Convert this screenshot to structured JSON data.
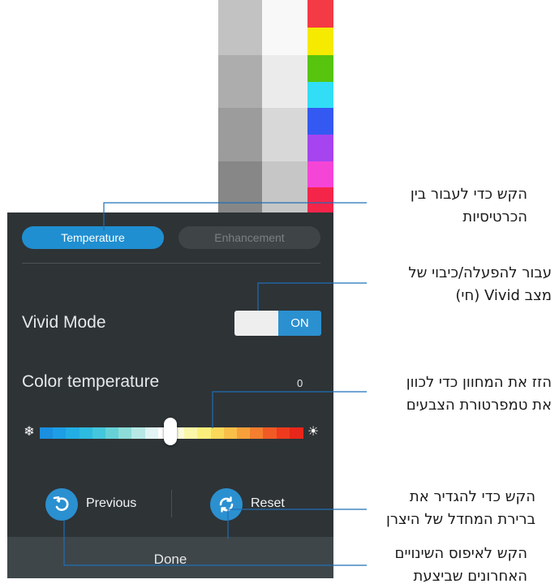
{
  "tabs": {
    "temperature": "Temperature",
    "enhancement": "Enhancement"
  },
  "vivid_mode": {
    "label": "Vivid Mode",
    "state": "ON"
  },
  "color_temperature": {
    "label": "Color temperature",
    "value": "0"
  },
  "actions": {
    "previous": "Previous",
    "reset": "Reset",
    "done": "Done"
  },
  "icons": {
    "cold": "snowflake-icon",
    "warm": "sun-icon",
    "previous": "undo-arrow-icon",
    "reset": "refresh-icon"
  },
  "colors": {
    "panel_bg": "#2e3336",
    "accent": "#1f8fd1",
    "done_bar": "#3e4649"
  },
  "callouts": {
    "tabs": [
      "הקש כדי לעבור בין",
      "הכרטיסיות"
    ],
    "vivid": [
      "עבור להפעלה/כיבוי של",
      "מצב Vivid (חי)"
    ],
    "slider": [
      "הזז את המחוון כדי לכוון",
      "את טמפרטורת הצבעים"
    ],
    "reset": [
      "הקש כדי להגדיר את",
      "ברירת המחדל של היצרן"
    ],
    "previous": [
      "הקש לאיפוס השינויים",
      "האחרונים שביצעת"
    ]
  }
}
